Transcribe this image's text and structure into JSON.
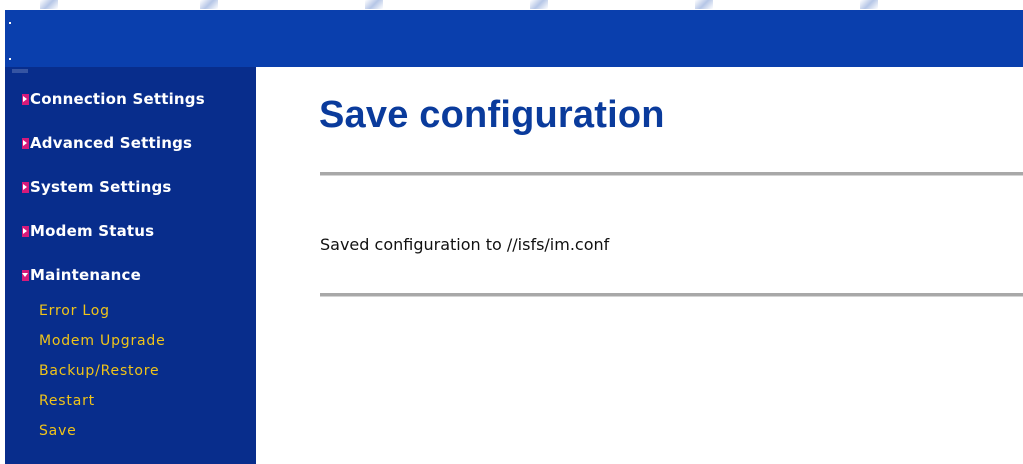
{
  "sidebar": {
    "sections": [
      {
        "label": "Connection Settings"
      },
      {
        "label": "Advanced Settings"
      },
      {
        "label": "System Settings"
      },
      {
        "label": "Modem Status"
      },
      {
        "label": "Maintenance",
        "expanded": true
      }
    ],
    "maintenance_items": [
      {
        "label": "Error Log"
      },
      {
        "label": "Modem Upgrade"
      },
      {
        "label": "Backup/Restore"
      },
      {
        "label": "Restart"
      },
      {
        "label": "Save"
      }
    ]
  },
  "main": {
    "title": "Save configuration",
    "message": "Saved configuration to //isfs/im.conf"
  },
  "colors": {
    "header": "#0a3fad",
    "sidebar": "#082d8c",
    "submenu_text": "#f0c419",
    "bullet": "#d61a7a",
    "title": "#0a3b9c"
  }
}
